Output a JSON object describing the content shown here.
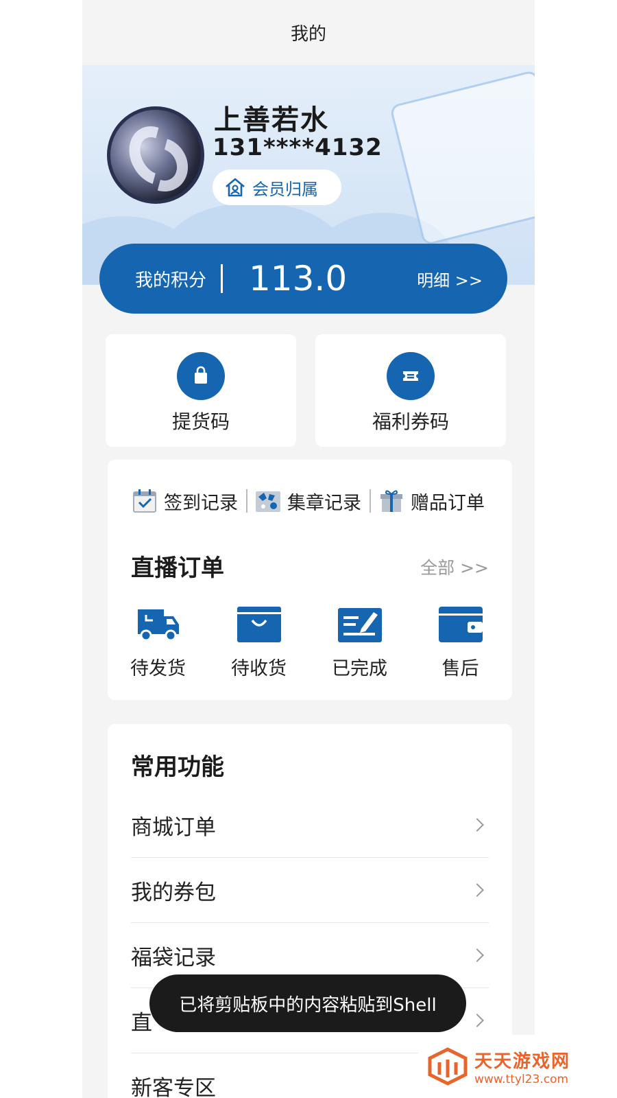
{
  "header": {
    "title": "我的"
  },
  "profile": {
    "name": "上善若水",
    "phone": "131****4132",
    "member_label": "会员归属"
  },
  "points": {
    "label": "我的积分",
    "value": "113.0",
    "detail_label": "明细 >>"
  },
  "quick_actions": [
    {
      "label": "提货码",
      "icon": "shopping-bag-icon"
    },
    {
      "label": "福利券码",
      "icon": "ticket-icon"
    }
  ],
  "record_links": [
    {
      "label": "签到记录",
      "icon": "calendar-check-icon"
    },
    {
      "label": "集章记录",
      "icon": "stamp-icon"
    },
    {
      "label": "赠品订单",
      "icon": "gift-icon"
    }
  ],
  "live_orders": {
    "title": "直播订单",
    "all_label": "全部 >>",
    "items": [
      {
        "label": "待发货",
        "icon": "truck-icon"
      },
      {
        "label": "待收货",
        "icon": "box-icon"
      },
      {
        "label": "已完成",
        "icon": "edit-check-icon"
      },
      {
        "label": "售后",
        "icon": "wallet-icon"
      }
    ]
  },
  "common_functions": {
    "title": "常用功能",
    "items": [
      {
        "label": "商城订单"
      },
      {
        "label": "我的券包"
      },
      {
        "label": "福袋记录"
      },
      {
        "label": "直"
      },
      {
        "label": "新客专区"
      }
    ]
  },
  "toast": {
    "message": "已将剪贴板中的内容粘贴到Shell"
  },
  "watermark": {
    "name": "天天游戏网",
    "url": "www.ttyl23.com"
  },
  "colors": {
    "accent": "#1565b0",
    "background": "#f4f4f4",
    "watermark": "#e8642a"
  }
}
